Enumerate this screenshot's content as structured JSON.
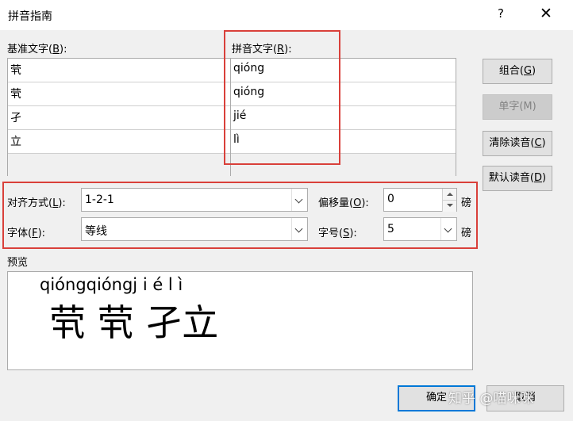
{
  "dialog": {
    "title": "拼音指南",
    "help_glyph": "?",
    "close_glyph": "✕"
  },
  "labels": {
    "base_text": {
      "pre": "基准文字(",
      "key": "B",
      "post": "):"
    },
    "ruby_text": {
      "pre": "拼音文字(",
      "key": "R",
      "post": "):"
    },
    "alignment": {
      "pre": "对齐方式(",
      "key": "L",
      "post": "):"
    },
    "offset": {
      "pre": "偏移量(",
      "key": "O",
      "post": "):"
    },
    "font": {
      "pre": "字体(",
      "key": "F",
      "post": "):"
    },
    "size": {
      "pre": "字号(",
      "key": "S",
      "post": "):"
    },
    "unit": "磅",
    "preview": "预览"
  },
  "rows": [
    {
      "base": "茕",
      "ruby": "qióng"
    },
    {
      "base": "茕",
      "ruby": "qióng"
    },
    {
      "base": "孑",
      "ruby": "jié"
    },
    {
      "base": "立",
      "ruby": "lì"
    }
  ],
  "buttons": {
    "combine": {
      "pre": "组合(",
      "key": "G",
      "post": ")"
    },
    "single": "单字(M)",
    "clear": {
      "pre": "清除读音(",
      "key": "C",
      "post": ")"
    },
    "default": {
      "pre": "默认读音(",
      "key": "D",
      "post": ")"
    },
    "ok": "确定",
    "cancel": "取消"
  },
  "fields": {
    "alignment": "1-2-1",
    "offset": "0",
    "font": "等线",
    "size": "5"
  },
  "preview": {
    "ruby_line": "qióngqióngj i é l ì",
    "base_line": "茕 茕 孑立"
  },
  "watermark": "知乎 @喵咪咪",
  "colors": {
    "highlight_border": "#d9403a",
    "focus_border": "#0078d7",
    "dialog_bg": "#f0f0f0"
  }
}
